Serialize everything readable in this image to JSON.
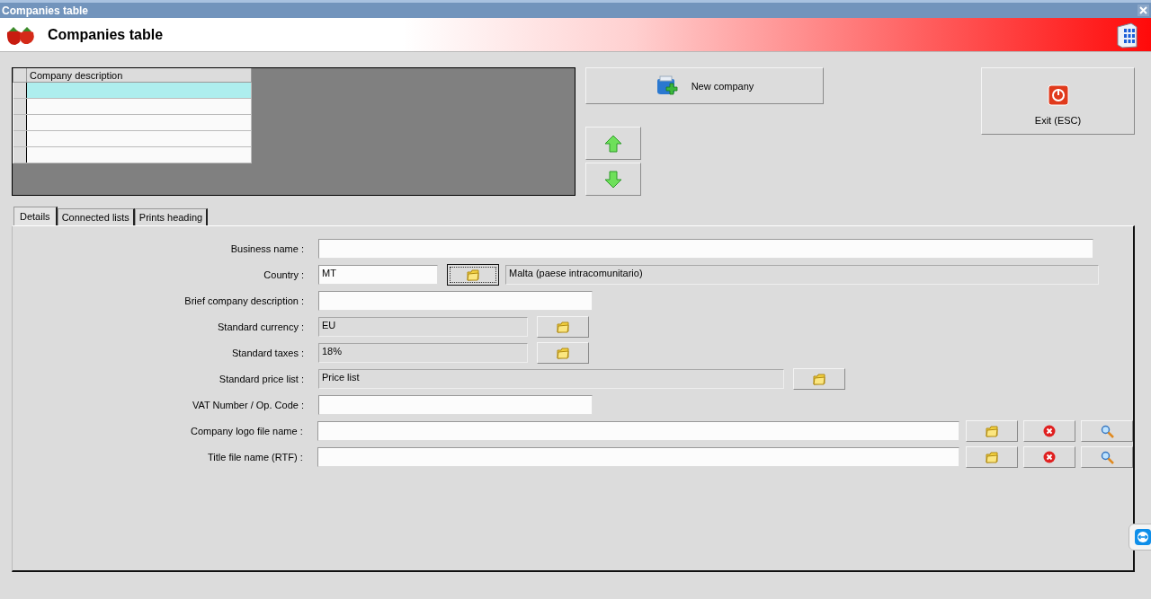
{
  "window": {
    "title": "Companies table"
  },
  "header": {
    "title": "Companies table"
  },
  "grid": {
    "columns": [
      "Company description"
    ],
    "rows": [
      {
        "selected": true
      },
      {
        "selected": false
      },
      {
        "selected": false
      },
      {
        "selected": false
      },
      {
        "selected": false
      }
    ]
  },
  "buttons": {
    "new": "New company",
    "exit": "Exit (ESC)"
  },
  "tabs": [
    {
      "label": "Details",
      "selected": true
    },
    {
      "label": "Connected lists",
      "selected": false
    },
    {
      "label": "Prints heading",
      "selected": false
    }
  ],
  "form": [
    {
      "label": "Business name :",
      "kind": "text"
    },
    {
      "label": "Country :",
      "kind": "text",
      "value": "MT",
      "buttons": [
        {
          "kind": "folder",
          "focused": true
        }
      ],
      "description": "Malta (paese intracomunitario)"
    },
    {
      "label": "Brief company description :",
      "kind": "text"
    },
    {
      "label": "Standard currency :",
      "kind": "readonly",
      "value": "EU",
      "buttons": [
        {
          "kind": "folder",
          "focused": false
        }
      ]
    },
    {
      "label": "Standard taxes :",
      "kind": "readonly",
      "value": "18%",
      "buttons": [
        {
          "kind": "folder",
          "focused": false
        }
      ]
    },
    {
      "label": "Standard price list :",
      "kind": "readonly",
      "value": "Price list",
      "buttons": [
        {
          "kind": "folder",
          "focused": false
        }
      ]
    },
    {
      "label": "VAT Number / Op. Code :",
      "kind": "text"
    },
    {
      "label": "Company logo file name :",
      "kind": "text",
      "buttons": [
        {
          "kind": "folder",
          "focused": false
        },
        {
          "kind": "delete",
          "focused": false
        },
        {
          "kind": "search",
          "focused": false
        }
      ]
    },
    {
      "label": "Title file name (RTF) :",
      "kind": "text",
      "buttons": [
        {
          "kind": "folder",
          "focused": false
        },
        {
          "kind": "delete",
          "focused": false
        },
        {
          "kind": "search",
          "focused": false
        }
      ]
    }
  ]
}
